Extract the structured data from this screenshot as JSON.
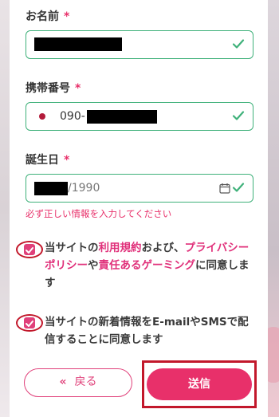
{
  "form": {
    "name": {
      "label": "お名前",
      "required_mark": "*"
    },
    "phone": {
      "label": "携帯番号",
      "required_mark": "*",
      "prefix": "090-"
    },
    "birthday": {
      "label": "誕生日",
      "required_mark": "*",
      "year_suffix": "/1990",
      "error": "必ず正しい情報を入力してください"
    },
    "consent_terms": {
      "checked": true,
      "text_1": "当サイトの",
      "link_terms": "利用規約",
      "text_2": "および、",
      "link_privacy": "プライバシーポリシー",
      "text_3": "や",
      "link_gaming": "責任あるゲーミング",
      "text_4": "に同意します"
    },
    "consent_news": {
      "checked": true,
      "text": "当サイトの新着情報をE-mailやSMSで配信することに同意します"
    }
  },
  "buttons": {
    "back_arrow": "«",
    "back_label": "戻る",
    "send_label": "送信"
  },
  "colors": {
    "accent": "#e8306a",
    "valid_border": "#3fb17a",
    "annotation_red": "#c2182b"
  },
  "icons": [
    "checkmark-icon",
    "calendar-icon",
    "flag-icon"
  ]
}
